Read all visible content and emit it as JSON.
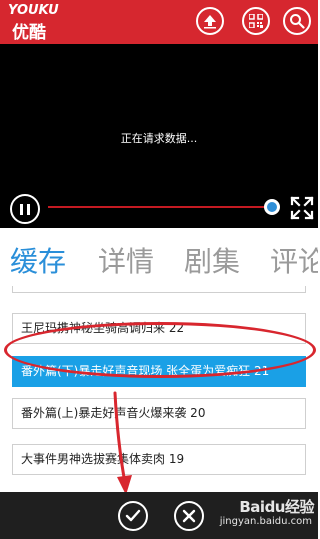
{
  "header": {
    "logo_en": "YOUKU",
    "logo_cn": "优酷",
    "background_color": "#d6272f",
    "buttons": [
      {
        "icon": "upload-icon"
      },
      {
        "icon": "qr-code-icon"
      },
      {
        "icon": "search-icon"
      }
    ]
  },
  "player": {
    "loading_text": "正在请求数据...",
    "progress": 0.98,
    "accent_color": "#2f8fd8",
    "controls": [
      {
        "icon": "pause-icon"
      },
      {
        "icon": "fullscreen-icon"
      }
    ]
  },
  "tabs": [
    {
      "label": "缓存",
      "active": true
    },
    {
      "label": "详情",
      "active": false
    },
    {
      "label": "剧集",
      "active": false
    },
    {
      "label": "评论",
      "active": false
    }
  ],
  "episodes": [
    {
      "title": "王尼玛携神秘坐骑高调归来 22",
      "selected": false
    },
    {
      "title": "番外篇(下)暴走好声音现场 张全蛋为爱痴狂 21",
      "selected": true
    },
    {
      "title": "番外篇(上)暴走好声音火爆来袭 20",
      "selected": false
    },
    {
      "title": "大事件男神选拔赛集体卖肉 19",
      "selected": false
    }
  ],
  "appbar": {
    "buttons": [
      {
        "icon": "checkmark-icon"
      },
      {
        "icon": "close-icon"
      }
    ]
  },
  "watermark": {
    "text": "Baidu经验",
    "sub": "jingyan.baidu.com"
  }
}
